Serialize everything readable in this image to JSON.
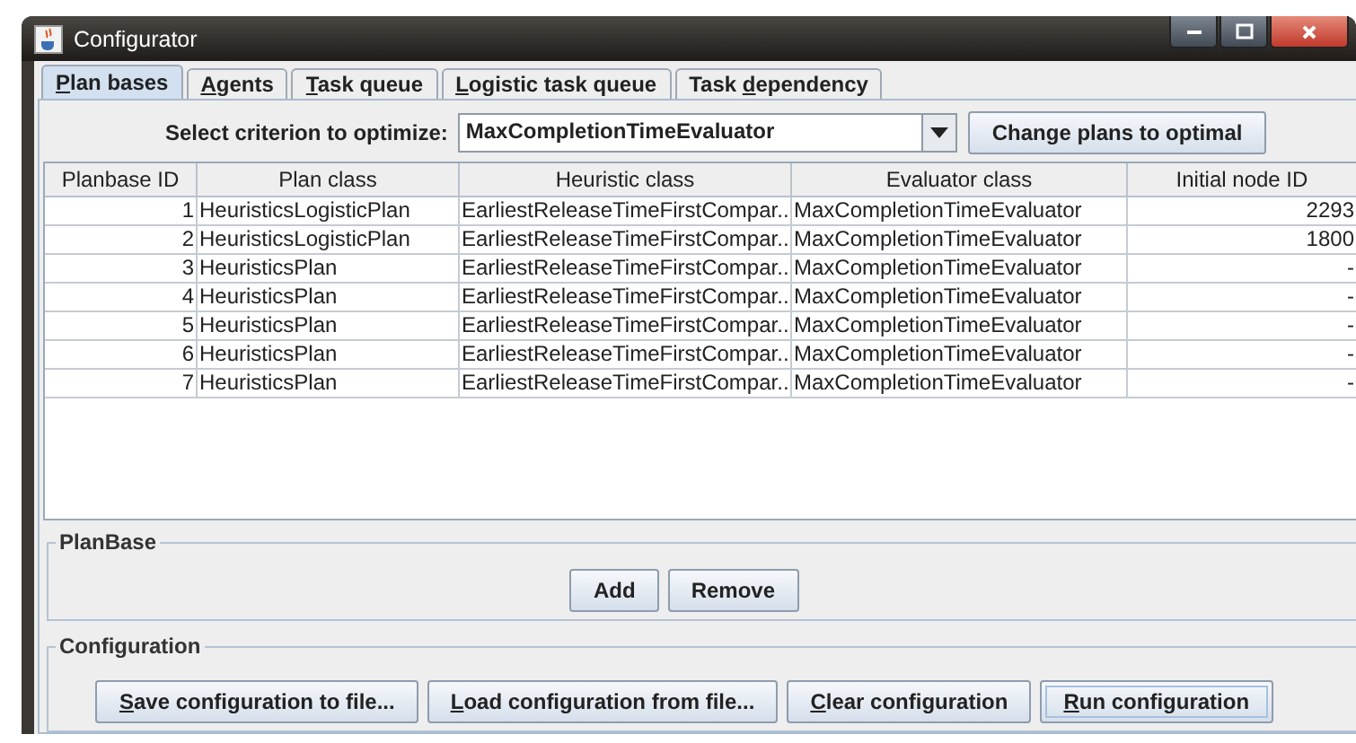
{
  "window": {
    "title": "Configurator"
  },
  "tabs": [
    {
      "key": "P",
      "post": "lan bases",
      "selected": true
    },
    {
      "key": "A",
      "post": "gents",
      "selected": false
    },
    {
      "key": "T",
      "post": "ask queue",
      "selected": false
    },
    {
      "key": "L",
      "post": "ogistic task queue",
      "selected": false
    },
    {
      "pre": "Task ",
      "key": "d",
      "post": "ependency",
      "selected": false
    }
  ],
  "criterion": {
    "label": "Select criterion to optimize:",
    "value": "MaxCompletionTimeEvaluator",
    "button": "Change plans to optimal"
  },
  "table": {
    "columns": [
      "Planbase ID",
      "Plan class",
      "Heuristic class",
      "Evaluator class",
      "Initial node ID"
    ],
    "rows": [
      [
        "1",
        "HeuristicsLogisticPlan",
        "EarliestReleaseTimeFirstCompar...",
        "MaxCompletionTimeEvaluator",
        "2293"
      ],
      [
        "2",
        "HeuristicsLogisticPlan",
        "EarliestReleaseTimeFirstCompar...",
        "MaxCompletionTimeEvaluator",
        "1800"
      ],
      [
        "3",
        "HeuristicsPlan",
        "EarliestReleaseTimeFirstCompar...",
        "MaxCompletionTimeEvaluator",
        "-"
      ],
      [
        "4",
        "HeuristicsPlan",
        "EarliestReleaseTimeFirstCompar...",
        "MaxCompletionTimeEvaluator",
        "-"
      ],
      [
        "5",
        "HeuristicsPlan",
        "EarliestReleaseTimeFirstCompar...",
        "MaxCompletionTimeEvaluator",
        "-"
      ],
      [
        "6",
        "HeuristicsPlan",
        "EarliestReleaseTimeFirstCompar...",
        "MaxCompletionTimeEvaluator",
        "-"
      ],
      [
        "7",
        "HeuristicsPlan",
        "EarliestReleaseTimeFirstCompar...",
        "MaxCompletionTimeEvaluator",
        "-"
      ]
    ]
  },
  "planbase": {
    "title": "PlanBase",
    "buttons": [
      {
        "post": "Add",
        "focused": false
      },
      {
        "post": "Remove",
        "focused": false
      }
    ]
  },
  "configuration": {
    "title": "Configuration",
    "buttons": [
      {
        "key": "S",
        "post": "ave configuration to file...",
        "focused": false
      },
      {
        "key": "L",
        "post": "oad configuration from file...",
        "focused": false
      },
      {
        "key": "C",
        "post": "lear configuration",
        "focused": false
      },
      {
        "key": "R",
        "post": "un configuration",
        "focused": true
      }
    ]
  }
}
